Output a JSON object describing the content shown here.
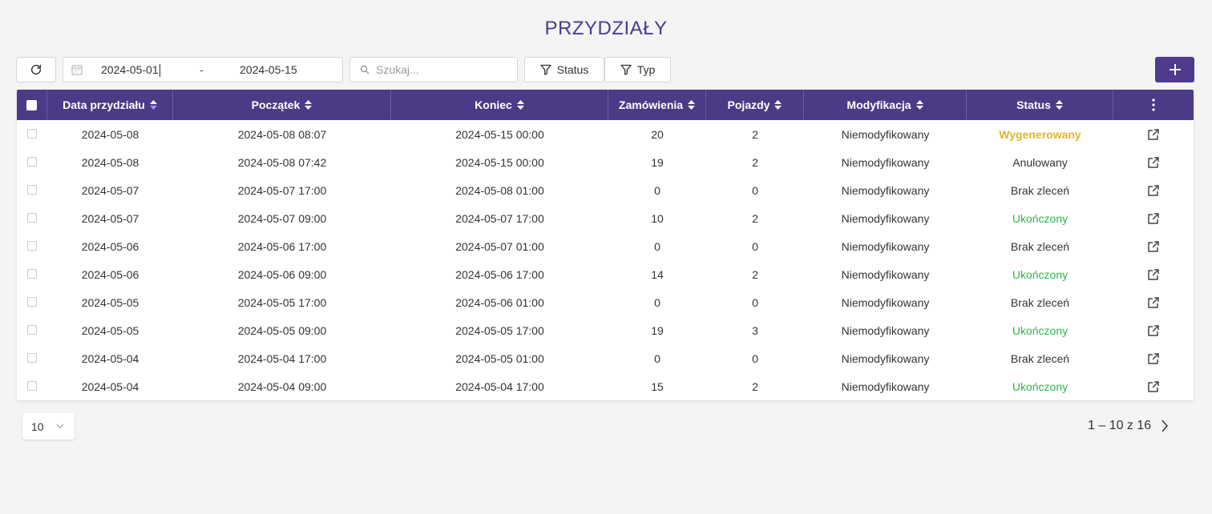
{
  "title": "PRZYDZIAŁY",
  "toolbar": {
    "date_start": "2024-05-01",
    "date_separator": "-",
    "date_end": "2024-05-15",
    "search_placeholder": "Szukaj...",
    "filter_status_label": "Status",
    "filter_type_label": "Typ",
    "add_icon": "plus-icon"
  },
  "colors": {
    "accent": "#4b3b86",
    "status_generated": "#e0b52b",
    "status_completed": "#2fb34a"
  },
  "table": {
    "headers": {
      "date": "Data przydziału",
      "start": "Początek",
      "end": "Koniec",
      "orders": "Zamówienia",
      "vehicles": "Pojazdy",
      "modification": "Modyfikacja",
      "status": "Status"
    },
    "rows": [
      {
        "date": "2024-05-08",
        "start": "2024-05-08 08:07",
        "end": "2024-05-15 00:00",
        "orders": "20",
        "vehicles": "2",
        "modification": "Niemodyfikowany",
        "status": "Wygenerowany",
        "status_kind": "gen"
      },
      {
        "date": "2024-05-08",
        "start": "2024-05-08 07:42",
        "end": "2024-05-15 00:00",
        "orders": "19",
        "vehicles": "2",
        "modification": "Niemodyfikowany",
        "status": "Anulowany",
        "status_kind": "plain"
      },
      {
        "date": "2024-05-07",
        "start": "2024-05-07 17:00",
        "end": "2024-05-08 01:00",
        "orders": "0",
        "vehicles": "0",
        "modification": "Niemodyfikowany",
        "status": "Brak zleceń",
        "status_kind": "plain"
      },
      {
        "date": "2024-05-07",
        "start": "2024-05-07 09:00",
        "end": "2024-05-07 17:00",
        "orders": "10",
        "vehicles": "2",
        "modification": "Niemodyfikowany",
        "status": "Ukończony",
        "status_kind": "done"
      },
      {
        "date": "2024-05-06",
        "start": "2024-05-06 17:00",
        "end": "2024-05-07 01:00",
        "orders": "0",
        "vehicles": "0",
        "modification": "Niemodyfikowany",
        "status": "Brak zleceń",
        "status_kind": "plain"
      },
      {
        "date": "2024-05-06",
        "start": "2024-05-06 09:00",
        "end": "2024-05-06 17:00",
        "orders": "14",
        "vehicles": "2",
        "modification": "Niemodyfikowany",
        "status": "Ukończony",
        "status_kind": "done"
      },
      {
        "date": "2024-05-05",
        "start": "2024-05-05 17:00",
        "end": "2024-05-06 01:00",
        "orders": "0",
        "vehicles": "0",
        "modification": "Niemodyfikowany",
        "status": "Brak zleceń",
        "status_kind": "plain"
      },
      {
        "date": "2024-05-05",
        "start": "2024-05-05 09:00",
        "end": "2024-05-05 17:00",
        "orders": "19",
        "vehicles": "3",
        "modification": "Niemodyfikowany",
        "status": "Ukończony",
        "status_kind": "done"
      },
      {
        "date": "2024-05-04",
        "start": "2024-05-04 17:00",
        "end": "2024-05-05 01:00",
        "orders": "0",
        "vehicles": "0",
        "modification": "Niemodyfikowany",
        "status": "Brak zleceń",
        "status_kind": "plain"
      },
      {
        "date": "2024-05-04",
        "start": "2024-05-04 09:00",
        "end": "2024-05-04 17:00",
        "orders": "15",
        "vehicles": "2",
        "modification": "Niemodyfikowany",
        "status": "Ukończony",
        "status_kind": "done"
      }
    ]
  },
  "pagination": {
    "page_size": "10",
    "range_text": "1 – 10 z 16"
  }
}
